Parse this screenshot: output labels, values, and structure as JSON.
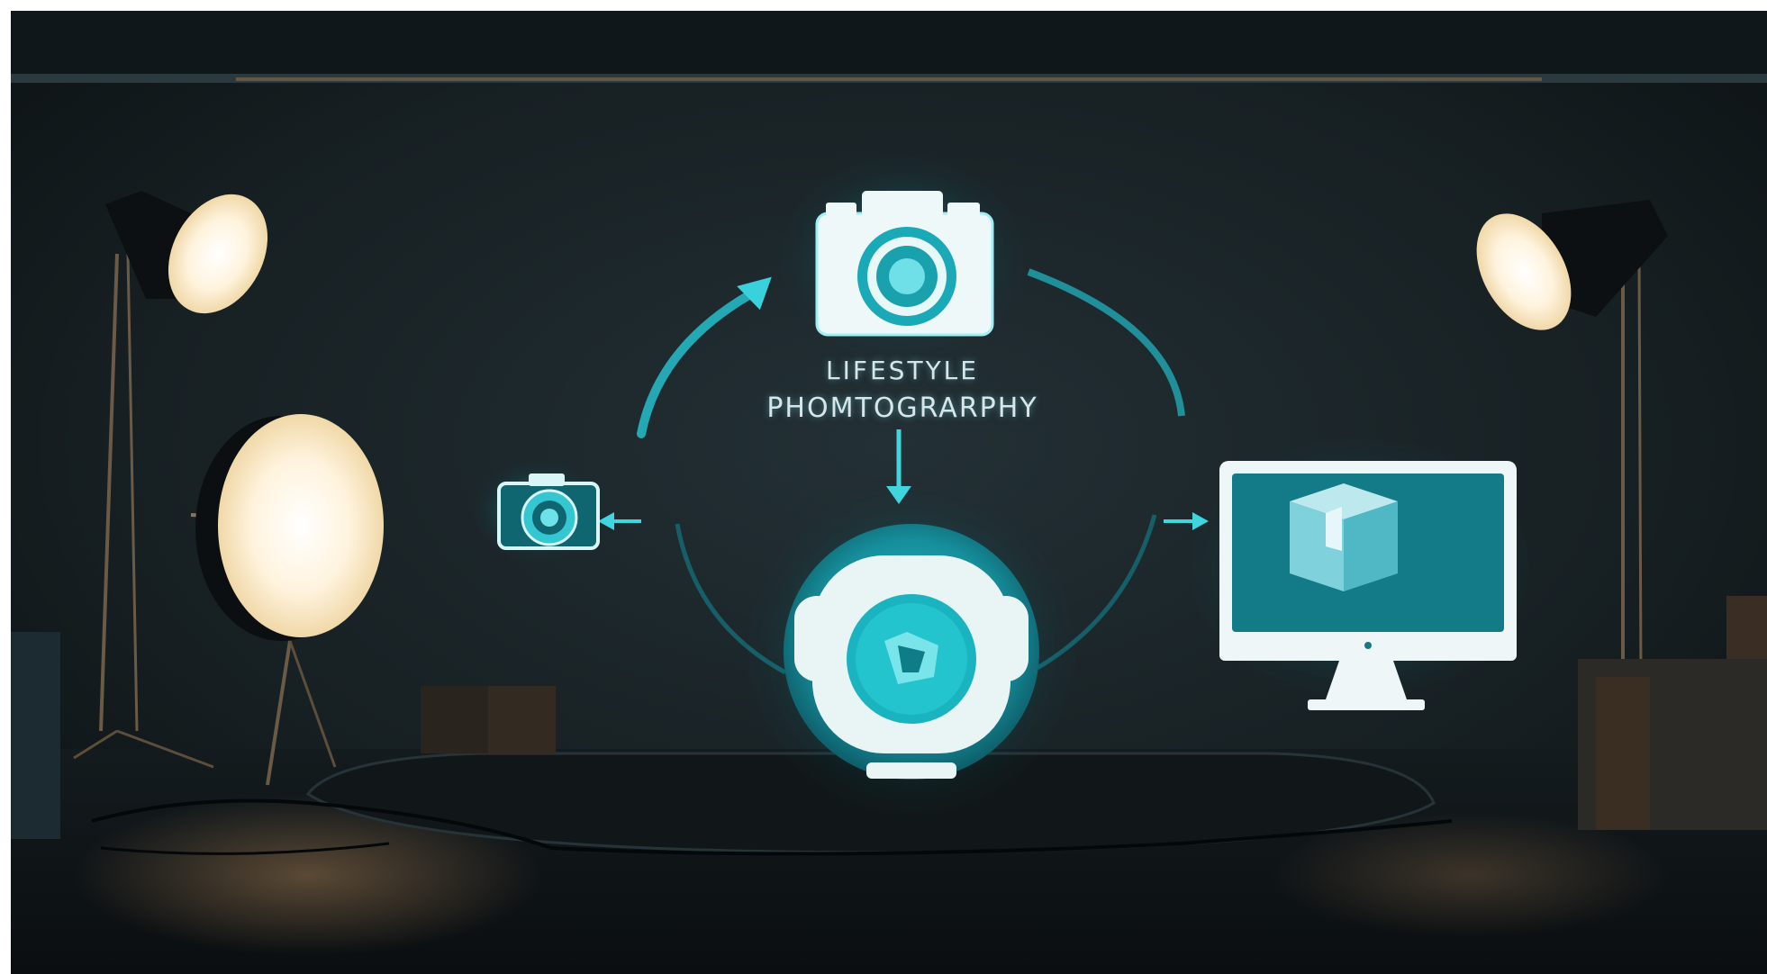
{
  "scene": {
    "title_line_1": "LIFESTYLE",
    "title_line_2": "PHOMTOGRARPHY",
    "colors": {
      "background": "#1b2326",
      "accent": "#36c9d4",
      "glow": "#19a9b8",
      "light_warm": "#fff6e6",
      "floor": "#0f1416"
    },
    "elements": {
      "main_icon": "camera-icon",
      "left_icon": "small-camera-icon",
      "bottom_icon": "lens-badge-icon",
      "right_icon": "monitor-box-icon"
    }
  }
}
